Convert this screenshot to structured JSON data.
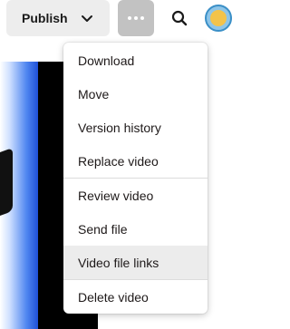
{
  "toolbar": {
    "publish_label": "Publish",
    "publish_icon": "chevron-down-icon",
    "more_icon": "more-horizontal-icon",
    "search_icon": "search-icon",
    "avatar_icon": "avatar"
  },
  "menu": {
    "items": [
      {
        "label": "Download"
      },
      {
        "label": "Move"
      },
      {
        "label": "Version history"
      },
      {
        "label": "Replace video"
      },
      {
        "label": "Review video"
      },
      {
        "label": "Send file"
      },
      {
        "label": "Video file links",
        "highlighted": true
      },
      {
        "label": "Delete video"
      }
    ]
  },
  "colors": {
    "more_button_bg": "#c2c2c2",
    "publish_bg": "#ededed",
    "highlight_bg": "#ececec"
  }
}
